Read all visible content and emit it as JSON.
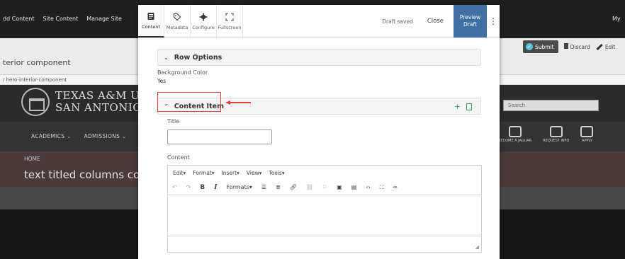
{
  "background": {
    "menu": [
      "dd Content",
      "Site Content",
      "Manage Site"
    ],
    "user_menu": "My",
    "component_title": "terior component",
    "path": "/ hero-interior-component",
    "actions": {
      "submit": "Submit",
      "discard": "Discard",
      "edit": "Edit"
    },
    "logo_line1": "TEXAS A&M U",
    "logo_line2": "SAN ANTONIO",
    "search_placeholder": "Search",
    "nav": [
      "ACADEMICS",
      "ADMISSIONS"
    ],
    "nav_icons": [
      "BECOME A JAGUAR",
      "REQUEST INFO",
      "APPLY"
    ],
    "breadcrumb_home": "HOME",
    "hero_title": "text titled columns co"
  },
  "toolbar": {
    "tools": [
      {
        "label": "Content",
        "icon": "content-icon"
      },
      {
        "label": "Metadata",
        "icon": "tag-icon"
      },
      {
        "label": "Configure",
        "icon": "gear-icon"
      },
      {
        "label": "Fullscreen",
        "icon": "fullscreen-icon"
      }
    ],
    "status": "Draft saved",
    "close": "Close",
    "preview_line1": "Preview",
    "preview_line2": "Draft"
  },
  "form": {
    "row_options": "Row Options",
    "background_color_label": "Background Color",
    "background_color_value": "Yes",
    "content_item": "Content Item",
    "title_label": "Title",
    "title_value": "",
    "content_label": "Content"
  },
  "editor": {
    "menus": [
      "Edit",
      "Format",
      "Insert",
      "View",
      "Tools"
    ],
    "formats": "Formats"
  },
  "colors": {
    "accent": "#3f6fa3",
    "add_green": "#3a9b57",
    "annotation_red": "#e04040"
  }
}
